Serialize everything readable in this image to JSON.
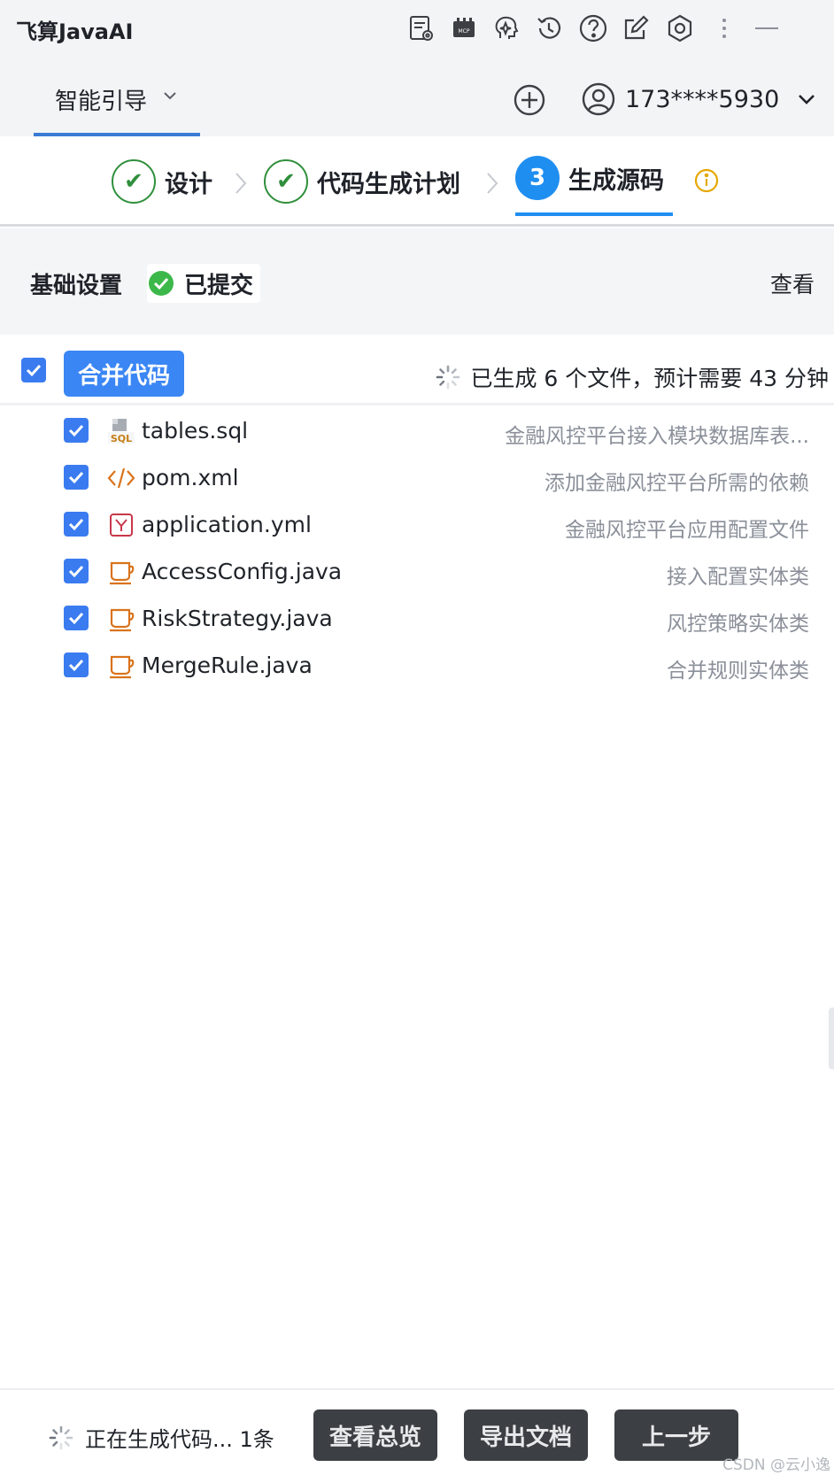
{
  "app": {
    "title": "飞算JavaAI"
  },
  "tabbar": {
    "active_tab": "智能引导",
    "user_name": "173****5930"
  },
  "steps": [
    {
      "label": "设计",
      "state": "done",
      "mark": "✔"
    },
    {
      "label": "代码生成计划",
      "state": "done",
      "mark": "✔"
    },
    {
      "label": "生成源码",
      "state": "active",
      "mark": "3"
    }
  ],
  "basic": {
    "title": "基础设置",
    "status": "已提交",
    "view_label": "查看"
  },
  "merge": {
    "button_label": "合并代码",
    "status_text": "已生成 6 个文件，预计需要 43 分钟"
  },
  "files": [
    {
      "name": "tables.sql",
      "desc": "金融风控平台接入模块数据库表...",
      "icon": "sql-file-icon"
    },
    {
      "name": "pom.xml",
      "desc": "添加金融风控平台所需的依赖",
      "icon": "xml-file-icon"
    },
    {
      "name": "application.yml",
      "desc": "金融风控平台应用配置文件",
      "icon": "yaml-file-icon"
    },
    {
      "name": "AccessConfig.java",
      "desc": "接入配置实体类",
      "icon": "java-file-icon"
    },
    {
      "name": "RiskStrategy.java",
      "desc": "风控策略实体类",
      "icon": "java-file-icon"
    },
    {
      "name": "MergeRule.java",
      "desc": "合并规则实体类",
      "icon": "java-file-icon"
    }
  ],
  "footer": {
    "status_text": "正在生成代码... 1条",
    "overview_label": "查看总览",
    "export_label": "导出文档",
    "prev_label": "上一步"
  },
  "watermark": "CSDN @云小逸",
  "colors": {
    "accent": "#3a86f4",
    "done_green": "#2f8f3c",
    "step_blue": "#1f8ef1",
    "footer_button": "#3c3f43",
    "info_yellow": "#e5a800"
  }
}
